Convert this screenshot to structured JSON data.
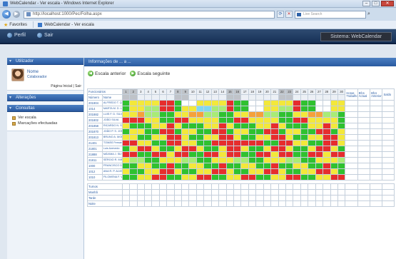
{
  "window": {
    "title": "WebCalendar - Ver escala - Windows Internet Explorer",
    "minimize": "–",
    "maximize": "□",
    "close": "✕"
  },
  "address_bar": {
    "url": "http://localhost:1000/Pec/Folha.aspx",
    "search_placeholder": "Live Search"
  },
  "favorites_bar": {
    "favorites_label": "Favorites",
    "tab_label": "WebCalendar - Ver escala"
  },
  "app_header": {
    "nav": [
      "Perfil",
      "Sair"
    ],
    "brand": "Sistema: WebCalendar"
  },
  "sidebar": {
    "user_panel_title": "Utilizador",
    "user_name": "Nome",
    "user_role": "Colaborador",
    "home_links": "Página Inicial | Sair",
    "panels": [
      "Alterações",
      "Consultas"
    ],
    "links": [
      "Ver escala",
      "Marcações efectuadas"
    ]
  },
  "main": {
    "header": "Informações de ... a ...",
    "prev_label": "Escala anterior",
    "next_label": "Escala seguinte",
    "grid": {
      "header_top": "Funcionários",
      "col_num": "Número",
      "col_name": "Nome",
      "days": [
        "1",
        "2",
        "3",
        "4",
        "5",
        "6",
        "7",
        "8",
        "9",
        "10",
        "11",
        "12",
        "13",
        "14",
        "15",
        "16",
        "17",
        "18",
        "19",
        "20",
        "21",
        "22",
        "23",
        "24",
        "25",
        "26",
        "27",
        "28",
        "29",
        "30"
      ],
      "weekend_days": [
        1,
        2,
        8,
        9,
        15,
        16,
        22,
        23
      ],
      "summary_headers": [
        "Horas Trabalho",
        "Bfcs Actual",
        "Bfcs Anterior",
        "Saldo"
      ],
      "rows": [
        {
          "num": "201904",
          "name": "ALFREDO T. QUINT",
          "cells": "GYYYYRRGWWYYYYRGGWWYYYYRGGWWYY",
          "sums": [
            "",
            "",
            "",
            ""
          ]
        },
        {
          "num": "1014",
          "name": "MARTA M. D. LEIS",
          "cells": "GYYLLRRGYYBBLLRGGWWYYLLRGGWWYY",
          "sums": [
            "",
            "",
            "",
            ""
          ]
        },
        {
          "num": "201882",
          "name": "LUIS F. D. SILV",
          "cells": "YYOLLGGYYOOLLGGYYOOLLGGYYOOLLG",
          "sums": [
            "",
            "",
            "",
            ""
          ]
        },
        {
          "num": "201802",
          "name": "JOÃO SILVA",
          "cells": "RRRYYGGRRYYYYGGRRYYYYGGRRYYYYG",
          "sums": [
            "",
            "",
            "",
            ""
          ]
        },
        {
          "num": "201858",
          "name": "RICARDO N. SILVA",
          "cells": "YGGGYYRYGGGYYRYGGGYYRYGGGYYRYG",
          "sums": [
            "",
            "",
            "",
            ""
          ]
        },
        {
          "num": "201870",
          "name": "JOÃO P. S. JORGE",
          "cells": "GYYGGRRGYYGGRRGYYGGRRGYYGGRRGY",
          "sums": [
            "",
            "",
            "",
            ""
          ]
        },
        {
          "num": "201813",
          "name": "BRUNO A. MOREIRA",
          "cells": "YYGGYYRRYGGYYRRYGGYYRRYGGYYRRY",
          "sums": [
            "",
            "",
            "",
            ""
          ]
        },
        {
          "num": "21401",
          "name": "TOMÁS Fernandes",
          "cells": "RRYYGGRRYYGGRRRRRRRGGRRYYGGRRY",
          "sums": [
            "",
            "",
            "",
            ""
          ]
        },
        {
          "num": "21801",
          "name": "Luis Azevedo",
          "cells": "GYRRYGGYRRYGGYRRYGGYRRYGGYRRYG",
          "sums": [
            "",
            "",
            "",
            ""
          ]
        },
        {
          "num": "21888",
          "name": "MÁXIMA J. SILVA",
          "cells": "RRGGRRYRRGGRRYRRGGRRYRRGGRRYRR",
          "sums": [
            "",
            "",
            "",
            ""
          ]
        },
        {
          "num": "21811",
          "name": "SÉRGIO R. MIRALA",
          "cells": "YLLGGYYYLLGGYYYLLGGYYYLLGGYYYL",
          "sums": [
            "",
            "",
            "",
            ""
          ]
        },
        {
          "num": "1000",
          "name": "FRANCISCO D. GONÇALV",
          "cells": "GGYYGGRGGYYGGRGGYYGGRGGYYGGRGG",
          "sums": [
            "",
            "",
            "",
            ""
          ]
        },
        {
          "num": "1012",
          "name": "ANA R. P. ALVES",
          "cells": "YGGYYRRYGGYYRRYGGYYRRYGGYYRRYG",
          "sums": [
            "",
            "",
            "",
            ""
          ]
        },
        {
          "num": "1010",
          "name": "FILOMENA F. VIDAL",
          "cells": "GGYYRRGGYYRRGGYYRRGGYYRRGGYYRR",
          "sums": [
            "",
            "",
            "",
            ""
          ]
        }
      ],
      "totals_title": "Turnos",
      "totals": [
        {
          "label": "Manhã",
          "values": [
            "",
            "",
            "",
            "",
            "",
            "",
            "",
            "",
            "",
            "",
            "",
            "",
            "",
            "",
            "",
            "",
            "",
            "",
            "",
            "",
            "",
            "",
            "",
            "",
            "",
            "",
            "",
            "",
            "",
            ""
          ]
        },
        {
          "label": "Tarde",
          "values": [
            "",
            "",
            "",
            "",
            "",
            "",
            "",
            "",
            "",
            "",
            "",
            "",
            "",
            "",
            "",
            "",
            "",
            "",
            "",
            "",
            "",
            "",
            "",
            "",
            "",
            "",
            "",
            "",
            "",
            ""
          ]
        },
        {
          "label": "Noite",
          "values": [
            "",
            "",
            "",
            "",
            "",
            "",
            "",
            "",
            "",
            "",
            "",
            "",
            "",
            "",
            "",
            "",
            "",
            "",
            "",
            "",
            "",
            "",
            "",
            "",
            "",
            "",
            "",
            "",
            "",
            ""
          ]
        }
      ]
    }
  },
  "colors": {
    "G": "#2fc12f",
    "Y": "#f3e83a",
    "R": "#e62d2d",
    "L": "#a8ec76",
    "O": "#f5a13a",
    "B": "#7fd8f0",
    "W": "#ffffff"
  }
}
